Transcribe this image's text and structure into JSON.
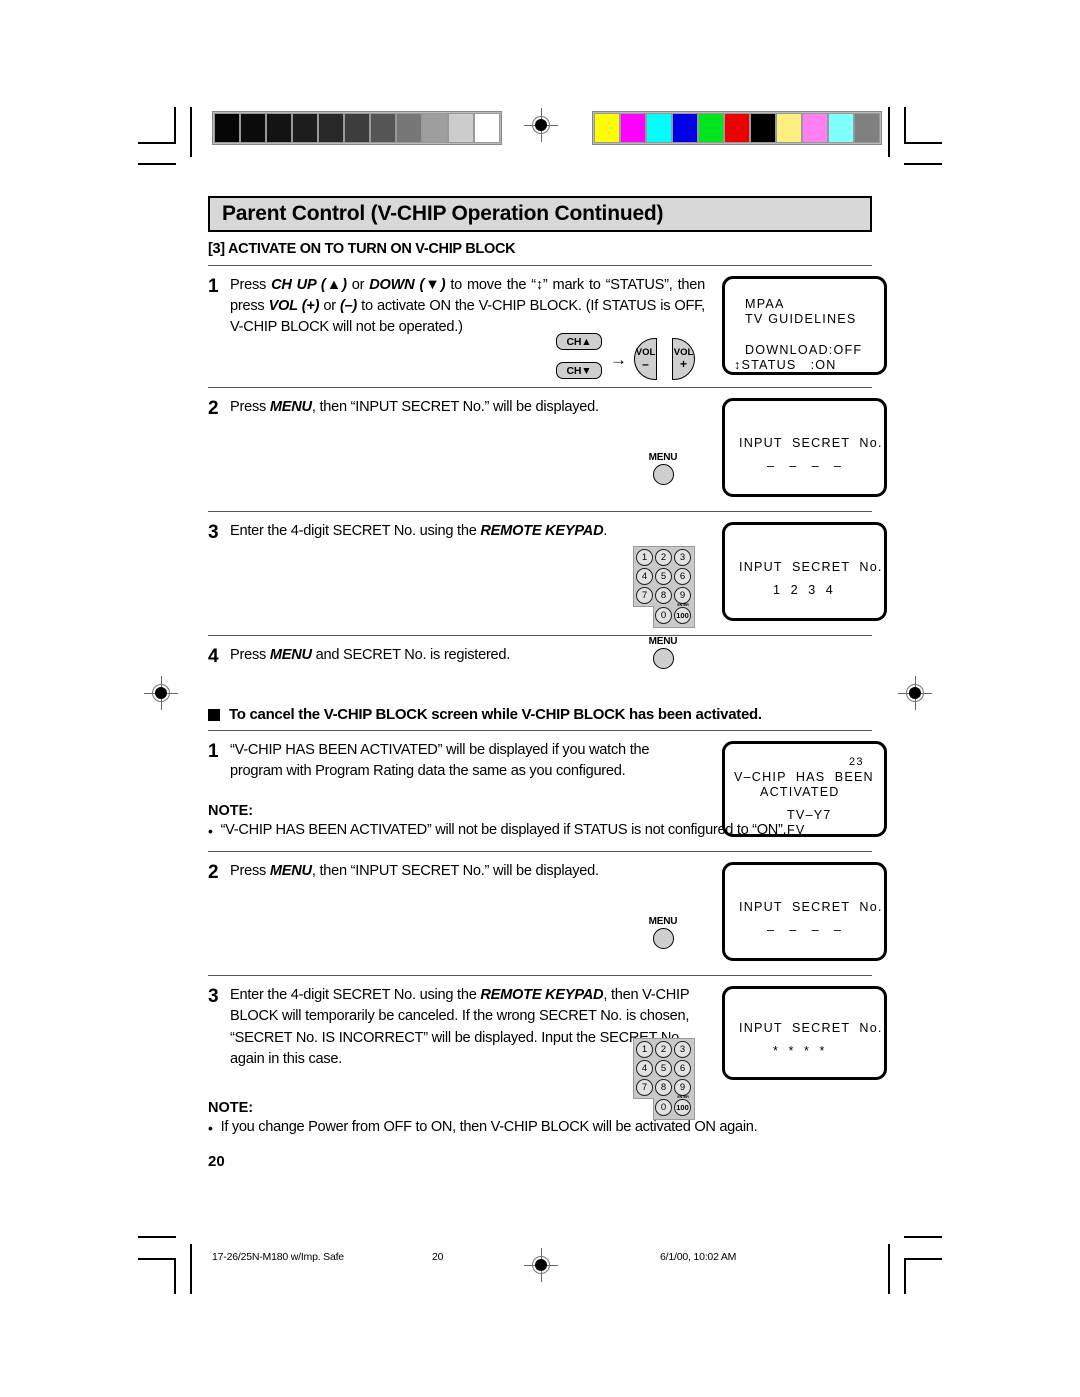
{
  "header": {
    "title": "Parent Control (V-CHIP Operation Continued)",
    "section": "[3] ACTIVATE ON TO TURN ON V-CHIP BLOCK"
  },
  "steps_primary": [
    {
      "num": "1",
      "text_parts": [
        {
          "t": "Press ",
          "s": "n"
        },
        {
          "t": "CH UP (▲)",
          "s": "bi"
        },
        {
          "t": " or ",
          "s": "n"
        },
        {
          "t": "DOWN (▼)",
          "s": "bi"
        },
        {
          "t": " to move the “↕” mark to “STATUS”, then press ",
          "s": "n"
        },
        {
          "t": "VOL (+)",
          "s": "bi"
        },
        {
          "t": " or ",
          "s": "n"
        },
        {
          "t": "(–)",
          "s": "bi"
        },
        {
          "t": " to activate ON the V-CHIP BLOCK. (If STATUS is OFF, V-CHIP BLOCK will not be operated.)",
          "s": "n"
        }
      ],
      "screen": {
        "name": "mpaa-status-screen",
        "lines": [
          "MPAA",
          "TV GUIDELINES",
          "DOWNLOAD:OFF",
          "↕STATUS   :ON"
        ]
      }
    },
    {
      "num": "2",
      "text_parts": [
        {
          "t": "Press ",
          "s": "n"
        },
        {
          "t": "MENU",
          "s": "bi"
        },
        {
          "t": ", then “INPUT SECRET No.” will be displayed.",
          "s": "n"
        }
      ],
      "screen": {
        "name": "input-secret-blank-screen",
        "lines": [
          "INPUT  SECRET  No.",
          "–   –   –   –"
        ]
      }
    },
    {
      "num": "3",
      "text_parts": [
        {
          "t": "Enter the 4-",
          "s": "n"
        },
        {
          "t": "digit",
          "s": "n"
        },
        {
          "t": " SECRET No. using the ",
          "s": "n"
        },
        {
          "t": "REMOTE KEYPAD",
          "s": "bi"
        },
        {
          "t": ".",
          "s": "n"
        }
      ],
      "screen": {
        "name": "input-secret-1234-screen",
        "lines": [
          "INPUT  SECRET  No.",
          "1  2  3  4"
        ]
      }
    },
    {
      "num": "4",
      "text_parts": [
        {
          "t": "Press ",
          "s": "n"
        },
        {
          "t": "MENU",
          "s": "bi"
        },
        {
          "t": " and SECRET No. is registered.",
          "s": "n"
        }
      ],
      "screen": null
    }
  ],
  "cancel_block": {
    "heading": "To cancel the V-CHIP BLOCK screen while V-CHIP BLOCK has been activated.",
    "steps": [
      {
        "num": "1",
        "text": "“V-CHIP HAS BEEN ACTIVATED” will be displayed if you watch the program with Program Rating data the same as you configured.",
        "screen": {
          "name": "vchip-activated-screen",
          "lines": [
            "23",
            "V–CHIP  HAS  BEEN",
            "ACTIVATED",
            "TV–Y7",
            "FV"
          ]
        }
      },
      {
        "num": "2",
        "text_parts": [
          {
            "t": "Press ",
            "s": "n"
          },
          {
            "t": "MENU",
            "s": "bi"
          },
          {
            "t": ", then “INPUT SECRET No.” will be displayed.",
            "s": "n"
          }
        ],
        "screen": {
          "name": "input-secret-blank-screen-2",
          "lines": [
            "INPUT  SECRET  No.",
            "–   –   –   –"
          ]
        }
      },
      {
        "num": "3",
        "text_parts": [
          {
            "t": "Enter the 4-digit SECRET No. using the ",
            "s": "n"
          },
          {
            "t": "REMOTE KEYPAD",
            "s": "bi"
          },
          {
            "t": ", then V-CHIP BLOCK will temporarily be canceled. If the wrong SECRET No. is chosen, “SECRET No. IS INCORRECT” will be displayed. Input the SECRET No. again in this case.",
            "s": "n"
          }
        ],
        "screen": {
          "name": "input-secret-masked-screen",
          "lines": [
            "INPUT  SECRET  No.",
            "*  *  *  *"
          ]
        }
      }
    ]
  },
  "notes": [
    {
      "label": "NOTE:",
      "bullet": "•",
      "text": "“V-CHIP HAS BEEN ACTIVATED” will not be displayed if STATUS is not configured to “ON”."
    },
    {
      "label": "NOTE:",
      "bullet": "•",
      "text": "If you change Power from OFF to ON, then V-CHIP BLOCK will be activated ON again."
    }
  ],
  "page_number": "20",
  "footer": {
    "document": "17-26/25N-M180 w/Imp. Safe",
    "page": "20",
    "timestamp": "6/1/00, 10:02 AM"
  },
  "remote": {
    "ch_up_label": "CH▲",
    "ch_down_label": "CH▼",
    "arrow": "→",
    "vol_label": "VOL",
    "vol_minus": "–",
    "vol_plus": "+",
    "menu_label": "MENU",
    "keypad_keys": [
      "1",
      "2",
      "3",
      "4",
      "5",
      "6",
      "7",
      "8",
      "9",
      "0",
      "100"
    ],
    "enter_sub_label": "ENTER"
  },
  "calibration": {
    "gray_swatches": [
      "#050505",
      "#0b0b0b",
      "#131313",
      "#1d1d1d",
      "#282828",
      "#3d3d3d",
      "#555555",
      "#777777",
      "#9e9e9e",
      "#cccccc",
      "#ffffff"
    ],
    "color_swatches": [
      "#ffff00",
      "#ff00ff",
      "#00ffff",
      "#0000e6",
      "#00e61e",
      "#ee0000",
      "#000000",
      "#ffee80",
      "#ff80f0",
      "#80ffff",
      "#808080"
    ]
  }
}
